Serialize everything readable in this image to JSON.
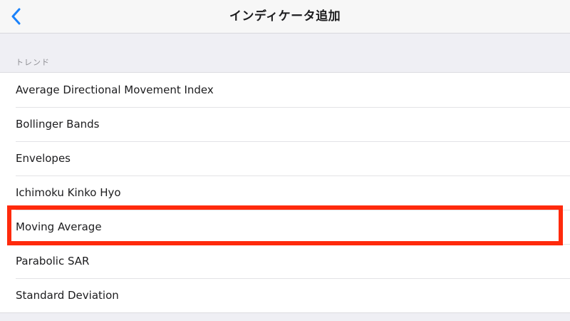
{
  "nav": {
    "title": "インディケータ追加",
    "back_icon": "chevron-left-icon",
    "accent_color": "#1a82fb"
  },
  "section": {
    "header": "トレンド",
    "items": [
      {
        "label": "Average Directional Movement Index"
      },
      {
        "label": "Bollinger Bands"
      },
      {
        "label": "Envelopes"
      },
      {
        "label": "Ichimoku Kinko Hyo"
      },
      {
        "label": "Moving Average"
      },
      {
        "label": "Parabolic SAR"
      },
      {
        "label": "Standard Deviation"
      }
    ]
  },
  "highlight": {
    "target": "Moving Average",
    "color": "#ff2a0c"
  }
}
